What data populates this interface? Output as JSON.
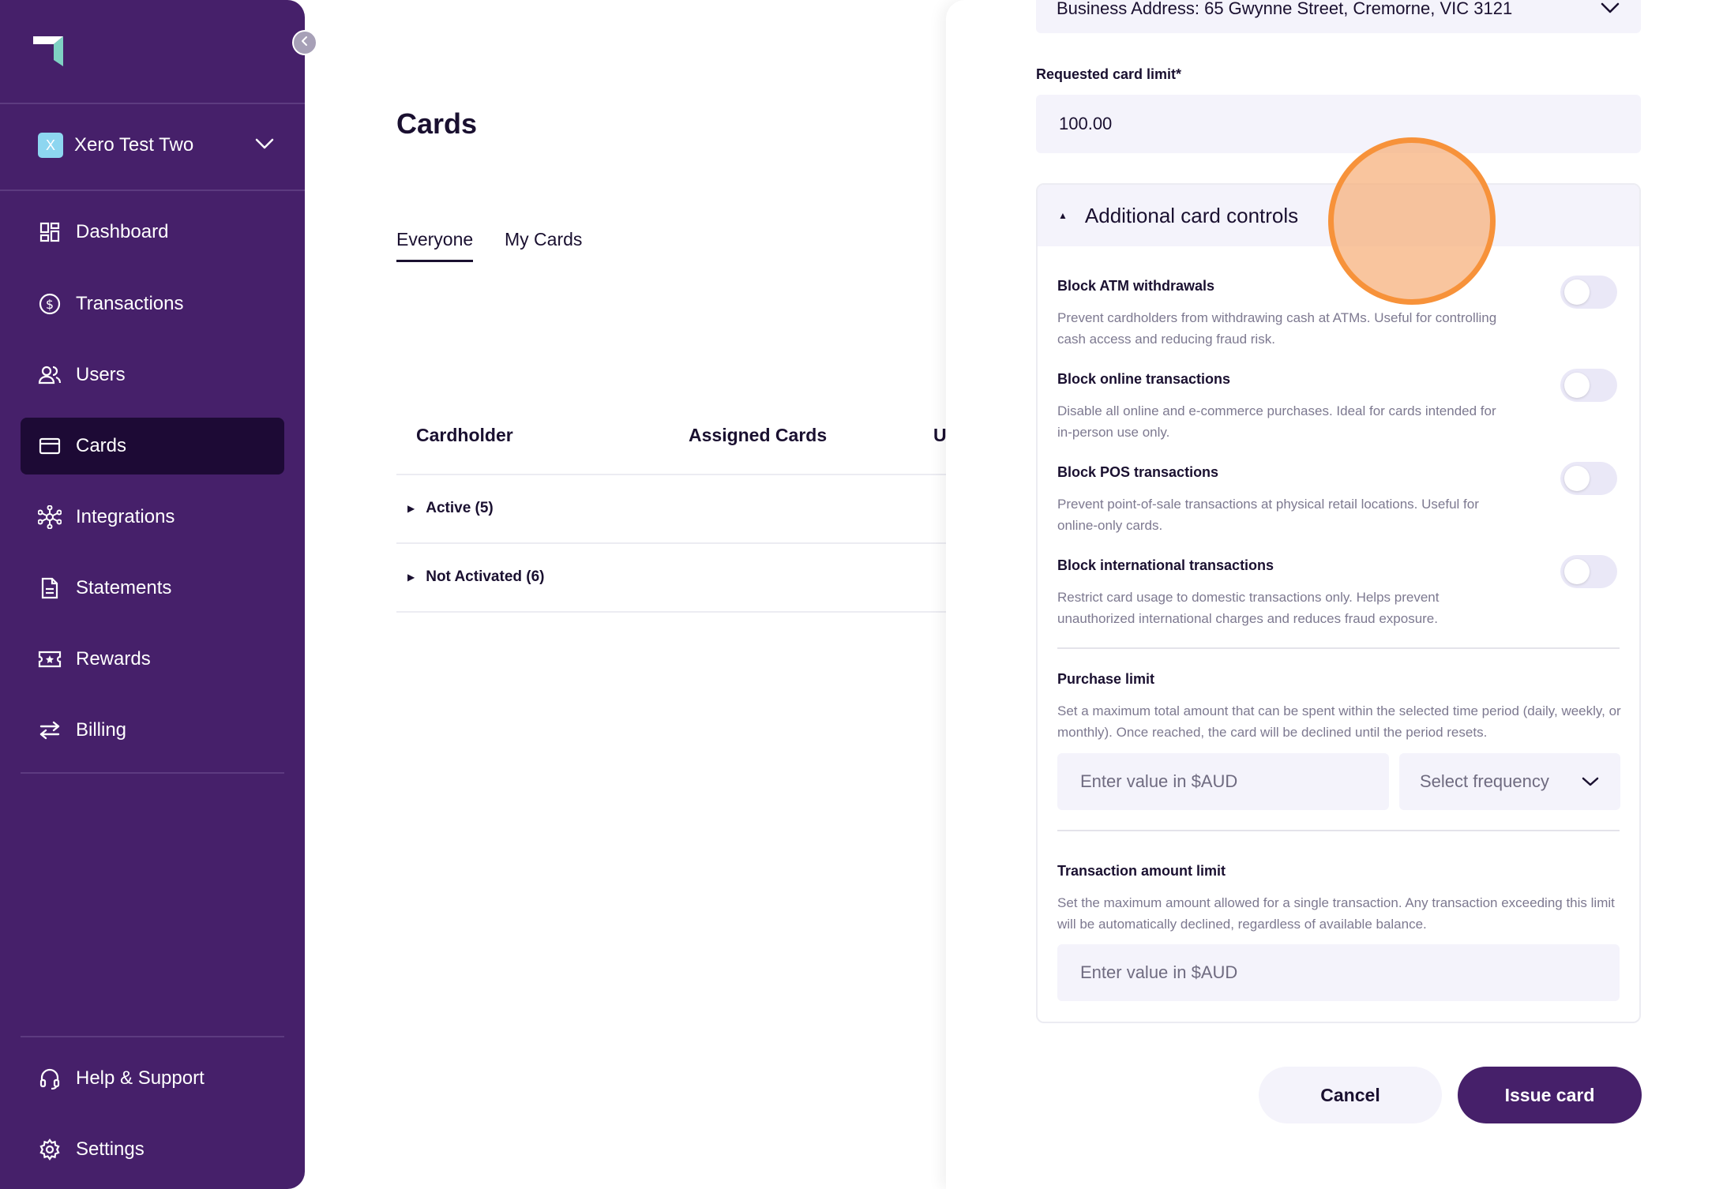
{
  "sidebar": {
    "org": {
      "badge": "X",
      "name": "Xero Test Two"
    },
    "items": [
      {
        "id": "dashboard",
        "label": "Dashboard",
        "icon": "dashboard-icon"
      },
      {
        "id": "transactions",
        "label": "Transactions",
        "icon": "dollar-circle-icon"
      },
      {
        "id": "users",
        "label": "Users",
        "icon": "users-icon"
      },
      {
        "id": "cards",
        "label": "Cards",
        "icon": "card-icon",
        "active": true
      },
      {
        "id": "integrations",
        "label": "Integrations",
        "icon": "network-icon"
      },
      {
        "id": "statements",
        "label": "Statements",
        "icon": "document-icon"
      },
      {
        "id": "rewards",
        "label": "Rewards",
        "icon": "ticket-star-icon"
      },
      {
        "id": "billing",
        "label": "Billing",
        "icon": "arrows-swap-icon"
      }
    ],
    "footer": [
      {
        "id": "help",
        "label": "Help & Support",
        "icon": "headset-icon"
      },
      {
        "id": "settings",
        "label": "Settings",
        "icon": "gear-icon"
      }
    ]
  },
  "main": {
    "title": "Cards",
    "tabs": [
      {
        "label": "Everyone",
        "active": true
      },
      {
        "label": "My Cards",
        "active": false
      }
    ],
    "columns": [
      "Cardholder",
      "Assigned Cards",
      "U"
    ],
    "groups": [
      {
        "label": "Active (5)"
      },
      {
        "label": "Not Activated (6)"
      }
    ]
  },
  "drawer": {
    "address": "Business Address: 65 Gwynne Street, Cremorne, VIC 3121",
    "card_limit": {
      "label": "Requested card limit*",
      "value": "100.00"
    },
    "controls": {
      "title": "Additional card controls",
      "toggles": [
        {
          "title": "Block ATM withdrawals",
          "desc": "Prevent cardholders from withdrawing cash at ATMs. Useful for controlling cash access and reducing fraud risk.",
          "on": false
        },
        {
          "title": "Block online transactions",
          "desc": "Disable all online and e-commerce purchases. Ideal for cards intended for in-person use only.",
          "on": false
        },
        {
          "title": "Block POS transactions",
          "desc": "Prevent point-of-sale transactions at physical retail locations. Useful for online-only cards.",
          "on": false
        },
        {
          "title": "Block international transactions",
          "desc": "Restrict card usage to domestic transactions only. Helps prevent unauthorized international charges and reduces fraud exposure.",
          "on": false
        }
      ],
      "purchase_limit": {
        "title": "Purchase limit",
        "desc": "Set a maximum total amount that can be spent within the selected time period (daily, weekly, or monthly). Once reached, the card will be declined until the period resets.",
        "placeholder": "Enter value in $AUD",
        "frequency_placeholder": "Select frequency"
      },
      "transaction_limit": {
        "title": "Transaction amount limit",
        "desc": "Set the maximum amount allowed for a single transaction. Any transaction exceeding this limit will be automatically declined, regardless of available balance.",
        "placeholder": "Enter value in $AUD"
      }
    },
    "actions": {
      "cancel": "Cancel",
      "issue": "Issue card"
    }
  },
  "colors": {
    "sidebar_bg": "#46206a",
    "active_nav": "#1d0a35",
    "field_bg": "#f4f3fb",
    "primary_button": "#46206a",
    "cursor_highlight": "#f7923a"
  }
}
